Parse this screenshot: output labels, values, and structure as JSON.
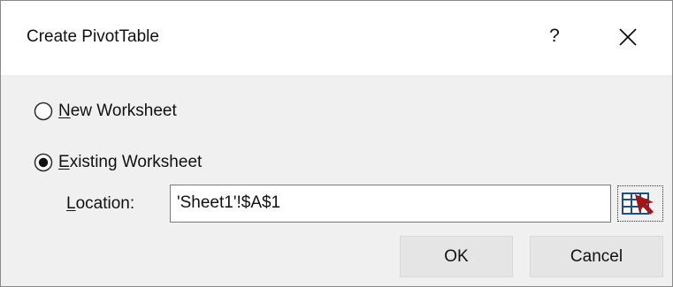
{
  "dialog": {
    "title": "Create PivotTable",
    "help_label": "?"
  },
  "options": [
    {
      "mnemonic": "N",
      "rest": "ew Worksheet",
      "selected": false
    },
    {
      "mnemonic": "E",
      "rest": "xisting Worksheet",
      "selected": true
    }
  ],
  "location": {
    "mnemonic": "L",
    "rest": "ocation:",
    "value": "'Sheet1'!$A$1"
  },
  "buttons": {
    "ok_label": "OK",
    "cancel_label": "Cancel"
  },
  "icons": {
    "help": "question-mark",
    "close": "close-x",
    "range_picker": "collapse-range-table-icon",
    "range_picker_accent": "#a1161b",
    "range_picker_grid": "#1b4f8c"
  },
  "colors": {
    "dialog_background": "#f0f0f0",
    "titlebar_background": "#ffffff",
    "button_background": "#e5e5e5"
  }
}
